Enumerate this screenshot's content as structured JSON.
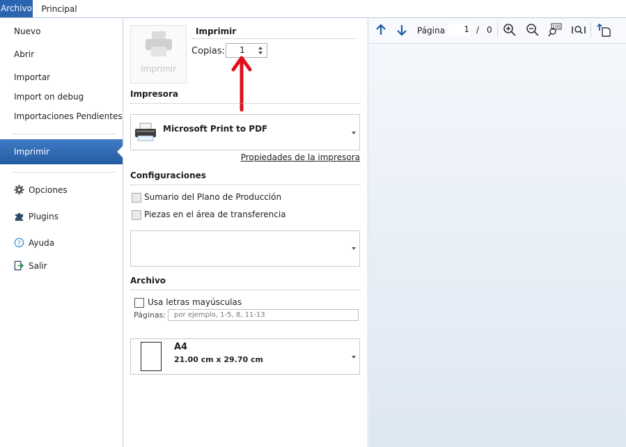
{
  "ribbon": {
    "tab_archivo": "Archivo",
    "tab_principal": "Principal"
  },
  "nav": {
    "nuevo": "Nuevo",
    "abrir": "Abrir",
    "importar": "Importar",
    "import_debug": "Import on debug",
    "importaciones_pendientes": "Importaciones Pendientes",
    "imprimir": "Imprimir",
    "opciones": "Opciones",
    "plugins": "Plugins",
    "ayuda": "Ayuda",
    "salir": "Salir"
  },
  "print": {
    "button_label": "Imprimir",
    "section_title": "Imprimir",
    "copies_label": "Copias:",
    "copies_value": "1"
  },
  "printer": {
    "section_title": "Impresora",
    "name": "Microsoft Print to PDF",
    "properties_link": "Propiedades de la impresora"
  },
  "settings": {
    "section_title": "Configuraciones",
    "options": [
      "Sumario del Plano de Producción",
      "Piezas en el área de transferencia"
    ]
  },
  "file": {
    "section_title": "Archivo",
    "uppercase_label": "Usa letras mayúsculas",
    "pages_label": "Páginas:",
    "pages_placeholder": "por ejemplo, 1-5, 8, 11-13"
  },
  "paper": {
    "name": "A4",
    "size": "21.00 cm x 29.70 cm"
  },
  "preview_toolbar": {
    "page_label": "Página",
    "page_current": "1",
    "page_separator": "/",
    "page_total": "0"
  },
  "colors": {
    "accent": "#2b64b0",
    "annotation_arrow": "#e0101b"
  }
}
